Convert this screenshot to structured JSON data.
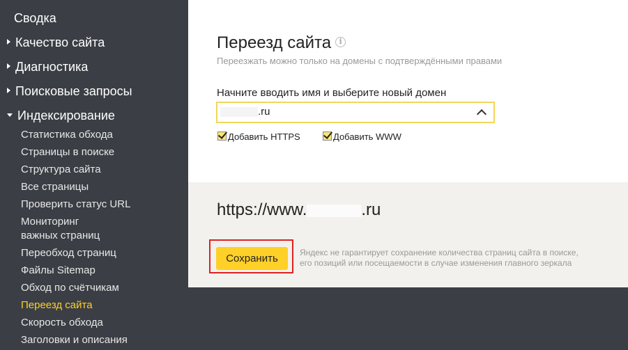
{
  "sidebar": {
    "summary": "Сводка",
    "sections": [
      {
        "label": "Качество сайта",
        "expanded": false
      },
      {
        "label": "Диагностика",
        "expanded": false
      },
      {
        "label": "Поисковые запросы",
        "expanded": false
      },
      {
        "label": "Индексирование",
        "expanded": true
      }
    ],
    "subitems": [
      {
        "label": "Статистика обхода"
      },
      {
        "label": "Страницы в поиске"
      },
      {
        "label": "Структура сайта"
      },
      {
        "label": "Все страницы"
      },
      {
        "label": "Проверить статус URL"
      },
      {
        "label": "Мониторинг"
      },
      {
        "label": "важных страниц"
      },
      {
        "label": "Переобход страниц"
      },
      {
        "label": "Файлы Sitemap"
      },
      {
        "label": "Обход по счётчикам"
      },
      {
        "label": "Переезд сайта",
        "active": true
      },
      {
        "label": "Скорость обхода"
      },
      {
        "label": "Заголовки и описания"
      }
    ]
  },
  "main": {
    "title": "Переезд сайта",
    "info_icon": "i",
    "subtitle": "Переезжать можно только на домены с подтверждёнными правами",
    "field_label": "Начните вводить имя и выберите новый домен",
    "domain_value_suffix": ".ru",
    "checkbox_https": "Добавить HTTPS",
    "checkbox_www": "Добавить WWW",
    "checkbox_https_checked": true,
    "checkbox_www_checked": true,
    "result_prefix": "https://www.",
    "result_suffix": ".ru",
    "save_label": "Сохранить",
    "note_line1": "Яндекс не гарантирует сохранение количества страниц сайта в поиске,",
    "note_line2": "его позиций или посещаемости в случае изменения главного зеркала"
  },
  "colors": {
    "sidebar_bg": "#3b3e44",
    "accent_yellow": "#ffd027",
    "highlight_red": "#e02020"
  }
}
